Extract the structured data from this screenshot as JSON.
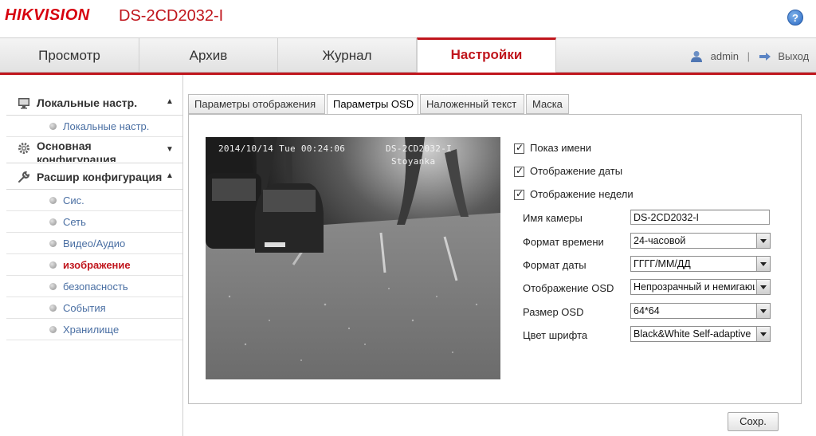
{
  "header": {
    "logo": "HIKVISION",
    "model": "DS-2CD2032-I",
    "help": "?"
  },
  "nav": {
    "tabs": [
      {
        "label": "Просмотр"
      },
      {
        "label": "Архив"
      },
      {
        "label": "Журнал"
      },
      {
        "label": "Настройки",
        "active": true
      }
    ],
    "user": "admin",
    "separator": "|",
    "logout": "Выход"
  },
  "sidebar": {
    "groups": [
      {
        "title": "Локальные настр.",
        "icon": "monitor-icon",
        "items": [
          {
            "label": "Локальные настр."
          }
        ]
      },
      {
        "title": "Основная конфигурация",
        "icon": "gear-icon",
        "items": []
      },
      {
        "title": "Расшир конфигурация",
        "icon": "wrench-icon",
        "items": [
          {
            "label": "Сис."
          },
          {
            "label": "Сеть"
          },
          {
            "label": "Видео/Аудио"
          },
          {
            "label": "изображение",
            "active": true
          },
          {
            "label": "безопасность"
          },
          {
            "label": "События"
          },
          {
            "label": "Хранилище"
          }
        ]
      }
    ]
  },
  "subtabs": [
    {
      "label": "Параметры отображения"
    },
    {
      "label": "Параметры OSD",
      "active": true
    },
    {
      "label": "Наложенный текст"
    },
    {
      "label": "Маска"
    }
  ],
  "video": {
    "osd_datetime": "2014/10/14 Tue 00:24:06",
    "osd_camera": "DS-2CD2032-I",
    "osd_overlay": "Stoyanka"
  },
  "osd": {
    "checkboxes": [
      {
        "label": "Показ имени",
        "checked": true
      },
      {
        "label": "Отображение даты",
        "checked": true
      },
      {
        "label": "Отображение недели",
        "checked": true
      }
    ],
    "camera_name_label": "Имя камеры",
    "camera_name_value": "DS-2CD2032-I",
    "time_format_label": "Формат времени",
    "time_format_value": "24-часовой",
    "date_format_label": "Формат даты",
    "date_format_value": "ГГГГ/ММ/ДД",
    "osd_display_label": "Отображение OSD",
    "osd_display_value": "Непрозрачный и немигающий",
    "osd_size_label": "Размер OSD",
    "osd_size_value": "64*64",
    "font_color_label": "Цвет шрифта",
    "font_color_value": "Black&White Self-adaptive"
  },
  "actions": {
    "save": "Сохр."
  },
  "colors": {
    "brand_red": "#c0161d",
    "link_blue": "#4a6fa3"
  }
}
